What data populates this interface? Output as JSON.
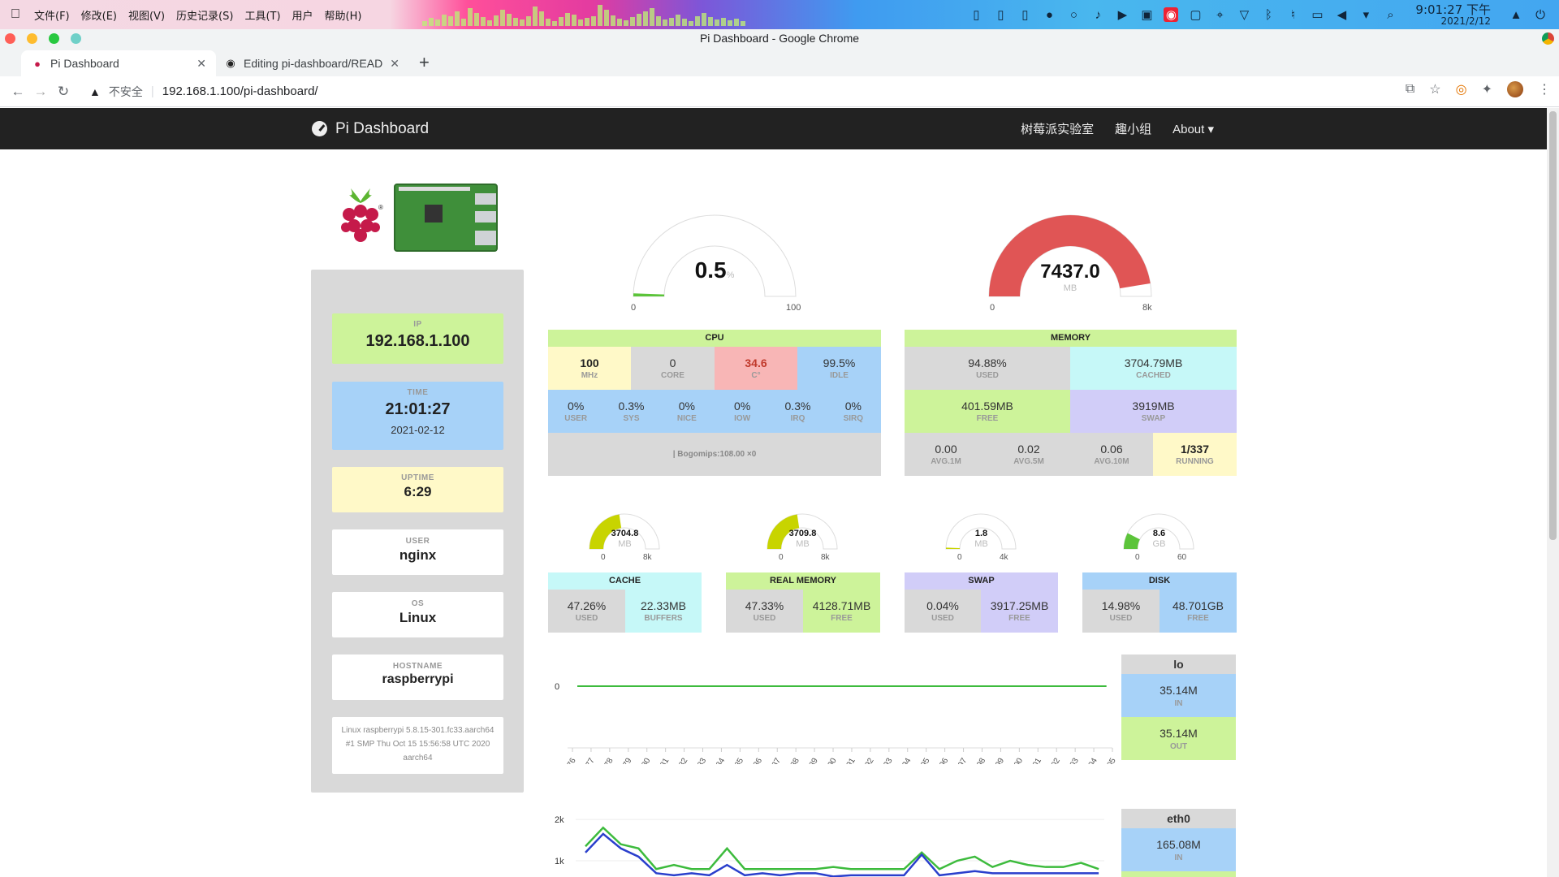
{
  "system": {
    "menu": [
      "文件(F)",
      "修改(E)",
      "视图(V)",
      "历史记录(S)",
      "工具(T)",
      "用户",
      "帮助(H)"
    ],
    "time": "9:01:27 下午",
    "date": "2021/2/12"
  },
  "browser": {
    "window_title": "Pi Dashboard - Google Chrome",
    "tabs": [
      {
        "title": "Pi Dashboard",
        "icon": "raspberry-icon"
      },
      {
        "title": "Editing pi-dashboard/READM",
        "icon": "github-icon"
      }
    ],
    "insecure_label": "不安全",
    "url": "192.168.1.100/pi-dashboard/"
  },
  "navbar": {
    "brand": "Pi Dashboard",
    "links": [
      "树莓派实验室",
      "趣小组"
    ],
    "about": "About"
  },
  "info": {
    "ip_label": "IP",
    "ip": "192.168.1.100",
    "time_label": "TIME",
    "time": "21:01:27",
    "date": "2021-02-12",
    "uptime_label": "UPTIME",
    "uptime": "6:29",
    "user_label": "USER",
    "user": "nginx",
    "os_label": "OS",
    "os": "Linux",
    "hostname_label": "HOSTNAME",
    "hostname": "raspberrypi",
    "kernel": "Linux raspberrypi 5.8.15-301.fc33.aarch64 #1 SMP Thu Oct 15 15:56:58 UTC 2020 aarch64"
  },
  "cpu_gauge": {
    "value": "0.5",
    "unit": "%",
    "min": "0",
    "max": "100",
    "fraction": 0.005
  },
  "mem_gauge": {
    "value": "7437.0",
    "unit": "MB",
    "min": "0",
    "max": "8k",
    "fraction": 0.9488
  },
  "cpu": {
    "title": "CPU",
    "freq": "100",
    "freq_label": "MHz",
    "core": "0",
    "core_label": "CORE",
    "temp": "34.6",
    "temp_label": "C°",
    "idle": "99.5%",
    "idle_label": "IDLE",
    "breakdown": [
      {
        "v": "0%",
        "l": "USER"
      },
      {
        "v": "0.3%",
        "l": "SYS"
      },
      {
        "v": "0%",
        "l": "NICE"
      },
      {
        "v": "0%",
        "l": "IOW"
      },
      {
        "v": "0.3%",
        "l": "IRQ"
      },
      {
        "v": "0%",
        "l": "SIRQ"
      }
    ],
    "bogomips": "| Bogomips:108.00 ×0"
  },
  "memory": {
    "title": "MEMORY",
    "used": "94.88%",
    "used_label": "USED",
    "cached": "3704.79MB",
    "cached_label": "CACHED",
    "free": "401.59MB",
    "free_label": "FREE",
    "swap": "3919MB",
    "swap_label": "SWAP",
    "load": [
      {
        "v": "0.00",
        "l": "AVG.1M"
      },
      {
        "v": "0.02",
        "l": "AVG.5M"
      },
      {
        "v": "0.06",
        "l": "AVG.10M"
      }
    ],
    "running": "1/337",
    "running_label": "RUNNING"
  },
  "small_gauges": [
    {
      "value": "3704.8",
      "unit": "MB",
      "min": "0",
      "max": "8k",
      "fraction": 0.4526,
      "color": "#c8d400"
    },
    {
      "value": "3709.8",
      "unit": "MB",
      "min": "0",
      "max": "8k",
      "fraction": 0.4533,
      "color": "#c8d400"
    },
    {
      "value": "1.8",
      "unit": "MB",
      "min": "0",
      "max": "4k",
      "fraction": 0.0004,
      "color": "#c8d400"
    },
    {
      "value": "8.6",
      "unit": "GB",
      "min": "0",
      "max": "60",
      "fraction": 0.1498,
      "color": "#5cc43a"
    }
  ],
  "small_tables": [
    {
      "title": "CACHE",
      "a": "47.26%",
      "a_label": "USED",
      "b": "22.33MB",
      "b_label": "BUFFERS"
    },
    {
      "title": "REAL MEMORY",
      "a": "47.33%",
      "a_label": "USED",
      "b": "4128.71MB",
      "b_label": "FREE"
    },
    {
      "title": "SWAP",
      "a": "0.04%",
      "a_label": "USED",
      "b": "3917.25MB",
      "b_label": "FREE"
    },
    {
      "title": "DISK",
      "a": "14.98%",
      "a_label": "USED",
      "b": "48.701GB",
      "b_label": "FREE"
    }
  ],
  "net": {
    "lo": {
      "name": "lo",
      "in": "35.14M",
      "in_label": "IN",
      "out": "35.14M",
      "out_label": "OUT"
    },
    "eth0": {
      "name": "eth0",
      "in": "165.08M",
      "in_label": "IN"
    }
  },
  "chart_data": [
    {
      "type": "line",
      "title": "lo",
      "x": [
        "776",
        "777",
        "778",
        "779",
        "780",
        "781",
        "782",
        "783",
        "784",
        "785",
        "786",
        "787",
        "788",
        "789",
        "790",
        "791",
        "792",
        "793",
        "794",
        "795",
        "796",
        "797",
        "798",
        "799",
        "800",
        "801",
        "802",
        "803",
        "804",
        "805"
      ],
      "yticks": [
        "0"
      ],
      "series": [
        {
          "values": [
            0,
            0,
            0,
            0,
            0,
            0,
            0,
            0,
            0,
            0,
            0,
            0,
            0,
            0,
            0,
            0,
            0,
            0,
            0,
            0,
            0,
            0,
            0,
            0,
            0,
            0,
            0,
            0,
            0,
            0
          ],
          "color": "#3dbb3d"
        }
      ],
      "grid": true
    },
    {
      "type": "line",
      "title": "eth0",
      "yticks": [
        "2k",
        "1k"
      ],
      "ylim": [
        0,
        2500
      ],
      "series": [
        {
          "values": [
            1350,
            1800,
            1400,
            1300,
            800,
            900,
            800,
            800,
            1300,
            800,
            800,
            800,
            800,
            800,
            850,
            800,
            800,
            800,
            800,
            1200,
            800,
            1000,
            1100,
            850,
            1000,
            900,
            850,
            850,
            950,
            800
          ],
          "color": "#3dbb3d"
        },
        {
          "values": [
            1200,
            1650,
            1300,
            1100,
            700,
            650,
            700,
            650,
            900,
            650,
            700,
            650,
            700,
            700,
            620,
            650,
            650,
            650,
            650,
            1150,
            650,
            700,
            750,
            700,
            700,
            700,
            700,
            700,
            700,
            700
          ],
          "color": "#2a3fcc"
        }
      ],
      "grid": true
    }
  ]
}
